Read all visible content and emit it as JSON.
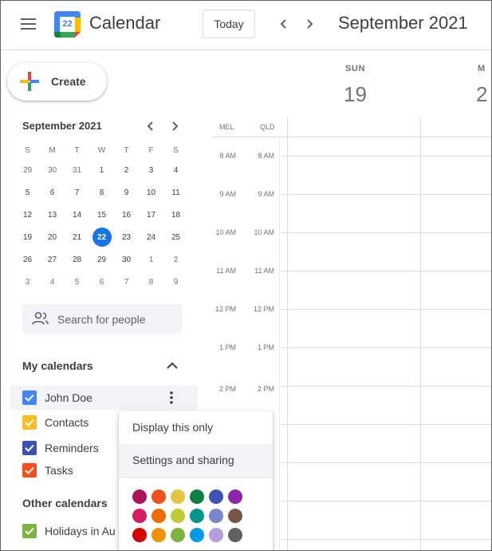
{
  "header": {
    "app_title": "Calendar",
    "logo_day": "22",
    "today_label": "Today",
    "month_title": "September 2021"
  },
  "create": {
    "label": "Create"
  },
  "mini_calendar": {
    "title": "September 2021",
    "weekdays": [
      "S",
      "M",
      "T",
      "W",
      "T",
      "F",
      "S"
    ],
    "weeks": [
      [
        "29",
        "30",
        "31",
        "1",
        "2",
        "3",
        "4"
      ],
      [
        "5",
        "6",
        "7",
        "8",
        "9",
        "10",
        "11"
      ],
      [
        "12",
        "13",
        "14",
        "15",
        "16",
        "17",
        "18"
      ],
      [
        "19",
        "20",
        "21",
        "22",
        "23",
        "24",
        "25"
      ],
      [
        "26",
        "27",
        "28",
        "29",
        "30",
        "1",
        "2"
      ],
      [
        "3",
        "4",
        "5",
        "6",
        "7",
        "8",
        "9"
      ]
    ],
    "today": "22"
  },
  "search_people": {
    "placeholder": "Search for people"
  },
  "my_calendars": {
    "title": "My calendars",
    "items": [
      {
        "label": "John Doe",
        "color": "#4285f4",
        "checked": true
      },
      {
        "label": "Contacts",
        "color": "#f6bf26",
        "checked": true
      },
      {
        "label": "Reminders",
        "color": "#3f51b5",
        "checked": true
      },
      {
        "label": "Tasks",
        "color": "#f4511e",
        "checked": true
      }
    ]
  },
  "other_calendars": {
    "title": "Other calendars",
    "items": [
      {
        "label": "Holidays in Au",
        "color": "#7cb342",
        "checked": true
      }
    ]
  },
  "week_view": {
    "days": [
      {
        "dow": "SUN",
        "date": "19"
      },
      {
        "dow": "M",
        "date": "2"
      }
    ],
    "timezones": [
      "MEL",
      "QLD"
    ],
    "hours_mel": [
      "8 AM",
      "9 AM",
      "10 AM",
      "11 AM",
      "12 PM",
      "1 PM",
      "2 PM"
    ],
    "hours_qld": [
      "8 AM",
      "9 AM",
      "10 AM",
      "11 AM",
      "12 PM",
      "1 PM",
      "2 PM"
    ]
  },
  "popup_menu": {
    "items": [
      "Display this only",
      "Settings and sharing"
    ],
    "colors": [
      [
        "#ad1457",
        "#f4511e",
        "#e4c441",
        "#0b8043",
        "#3f51b5",
        "#8e24aa"
      ],
      [
        "#d81b60",
        "#ef6c00",
        "#c0ca33",
        "#009688",
        "#7986cb",
        "#795548"
      ],
      [
        "#d50000",
        "#f09300",
        "#7cb342",
        "#039be5",
        "#b39ddb",
        "#616161"
      ]
    ]
  }
}
